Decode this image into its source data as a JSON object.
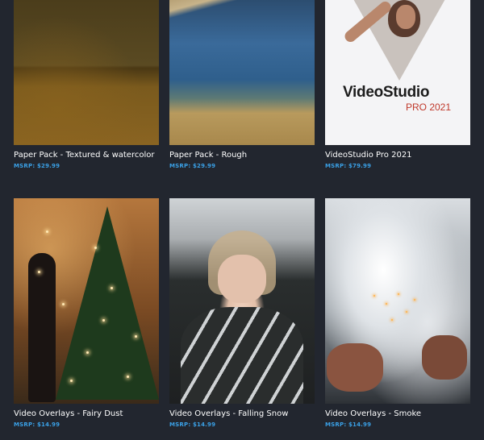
{
  "products": [
    {
      "title": "Paper Pack - Textured & watercolor",
      "price": "MSRP: $29.99",
      "image": "paper-textured-image"
    },
    {
      "title": "Paper Pack - Rough",
      "price": "MSRP: $29.99",
      "image": "paper-rough-image"
    },
    {
      "title": "VideoStudio Pro 2021",
      "price": "MSRP: $79.99",
      "image": "videostudio-box-image",
      "box": {
        "brand": "VideoStudio",
        "edition": "PRO 2021"
      }
    },
    {
      "title": "Video Overlays - Fairy Dust",
      "price": "MSRP: $14.99",
      "image": "fairy-dust-image"
    },
    {
      "title": "Video Overlays - Falling Snow",
      "price": "MSRP: $14.99",
      "image": "falling-snow-image"
    },
    {
      "title": "Video Overlays - Smoke",
      "price": "MSRP: $14.99",
      "image": "smoke-image"
    }
  ],
  "colors": {
    "background": "#22262f",
    "title": "#ffffff",
    "price": "#3aa0e6",
    "vs_accent": "#c0392b"
  }
}
